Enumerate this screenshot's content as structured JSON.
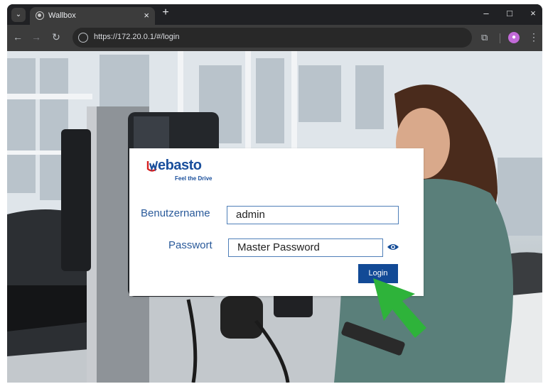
{
  "browser": {
    "tab": {
      "title": "Wallbox",
      "close_glyph": "×"
    },
    "new_tab_glyph": "+",
    "tab_menu_glyph": "⌄",
    "url": "https://172.20.0.1/#/login",
    "window_controls": {
      "minimize": "–",
      "maximize": "□",
      "close": "×"
    },
    "nav": {
      "back": "←",
      "forward": "→",
      "reload": "↻"
    },
    "extensions_glyph": "⧉",
    "menu_glyph": "⋮"
  },
  "brand": {
    "name": "Webasto",
    "logo_word": "ebasto",
    "tagline": "Feel the Drive",
    "color": "#1a4f9c"
  },
  "login": {
    "username_label": "Benutzername",
    "username_value": "admin",
    "password_label": "Passwort",
    "password_value": "Master Password",
    "submit_label": "Login"
  },
  "colors": {
    "accent": "#124a96",
    "pointer_arrow": "#2eb33a"
  },
  "icons": [
    "browser-favicon-icon",
    "site-info-icon",
    "extensions-icon",
    "profile-icon",
    "eye-icon",
    "pointer-arrow-icon"
  ]
}
